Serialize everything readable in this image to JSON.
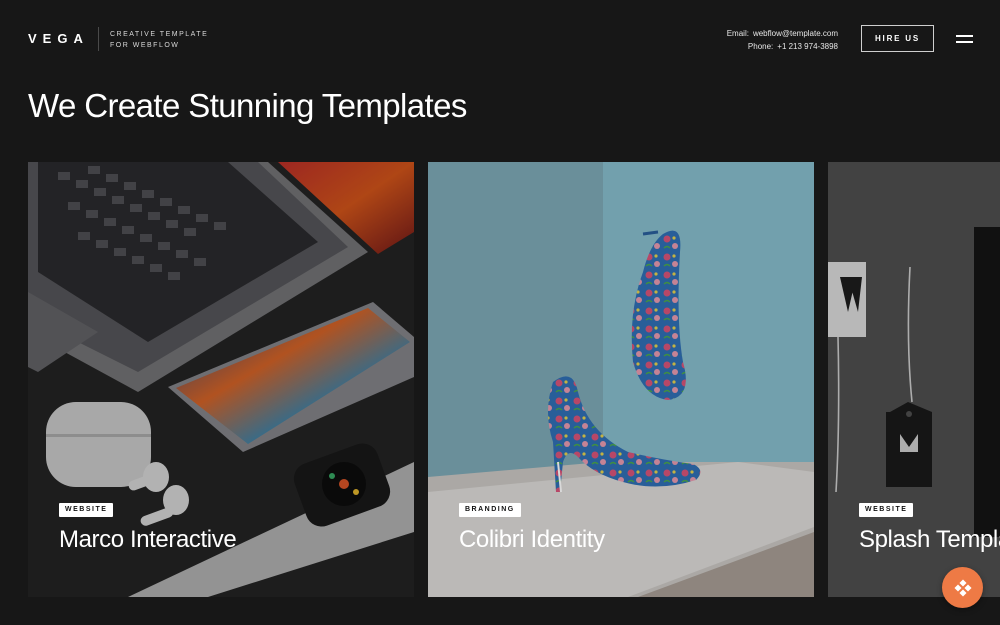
{
  "header": {
    "logo": "VEGA",
    "tagline_line1": "CREATIVE TEMPLATE",
    "tagline_line2": "FOR WEBFLOW",
    "email_label": "Email:",
    "email_value": "webflow@template.com",
    "phone_label": "Phone:",
    "phone_value": "+1 213 974-3898",
    "hire_label": "HIRE US",
    "menu_icon": "hamburger-icon"
  },
  "main": {
    "title": "We Create Stunning Templates"
  },
  "cards": [
    {
      "category": "WEBSITE",
      "name": "Marco Interactive",
      "image": "laptop-phone-watch-photo"
    },
    {
      "category": "BRANDING",
      "name": "Colibri Identity",
      "image": "floral-heels-photo"
    },
    {
      "category": "WEBSITE",
      "name": "Splash Templa",
      "image": "hang-tag-stationery-photo"
    }
  ],
  "fab": {
    "icon": "webflow-diamond-icon",
    "color": "#ee7a45"
  },
  "colors": {
    "background": "#171717",
    "accent": "#ee7a45",
    "badge_bg": "#ffffff"
  }
}
